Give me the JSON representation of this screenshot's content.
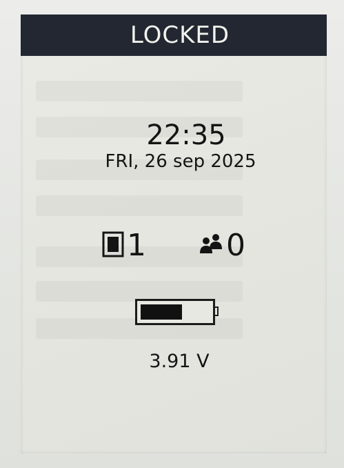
{
  "header": {
    "title": "LOCKED"
  },
  "clock": {
    "time": "22:35",
    "date": "FRI, 26 sep 2025"
  },
  "counters": {
    "device": {
      "icon": "device-icon",
      "value": "1"
    },
    "users": {
      "icon": "users-icon",
      "value": "0"
    }
  },
  "battery": {
    "icon": "battery-icon",
    "level": 0.6,
    "voltage": "3.91 V"
  },
  "colors": {
    "header_bg": "#222731",
    "header_text": "#f1f1ee",
    "screen_bg": "#e8e8e2",
    "ink": "#141414"
  }
}
